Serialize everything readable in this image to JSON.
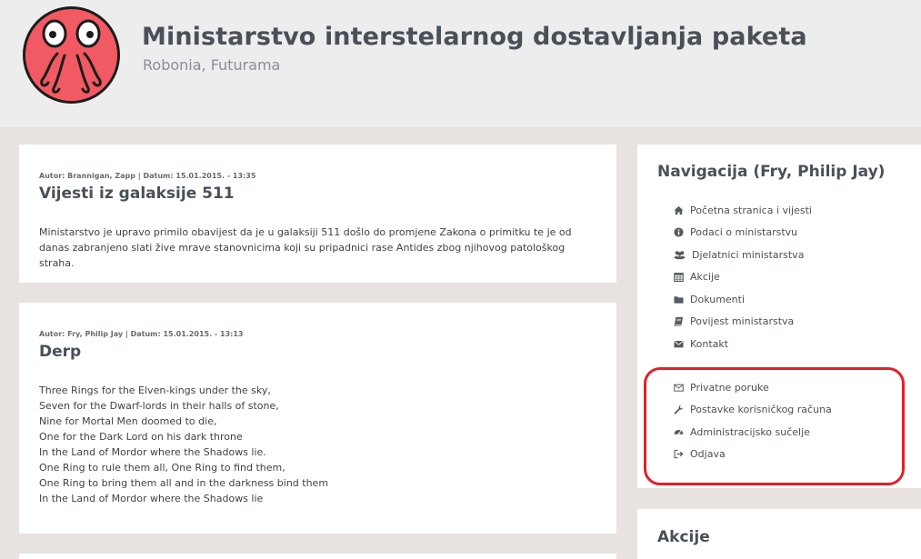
{
  "header": {
    "title": "Ministarstvo interstelarnog dostavljanja paketa",
    "subtitle": "Robonia, Futurama",
    "logo_icon": "zoidberg-logo-icon"
  },
  "posts": [
    {
      "meta": "Autor: Brannigan, Zapp | Datum: 15.01.2015. - 13:35",
      "title": "Vijesti iz galaksije 511",
      "body": "Ministarstvo je upravo primilo obavijest da je u galaksiji 511 došlo do promjene Zakona o primitku te je od danas zabranjeno slati žive mrave stanovnicima koji su pripadnici rase Antides zbog njihovog patološkog straha."
    },
    {
      "meta": "Autor: Fry, Philip Jay | Datum: 15.01.2015. - 13:13",
      "title": "Derp",
      "lines": [
        "Three Rings for the Elven-kings under the sky,",
        "Seven for the Dwarf-lords in their halls of stone,",
        "Nine for Mortal Men doomed to die,",
        "One for the Dark Lord on his dark throne",
        "In the Land of Mordor where the Shadows lie.",
        "One Ring to rule them all, One Ring to find them,",
        "One Ring to bring them all and in the darkness bind them",
        "In the Land of Mordor where the Shadows lie"
      ]
    }
  ],
  "sidebar": {
    "nav_title": "Navigacija (Fry, Philip Jay)",
    "nav_items": [
      {
        "label": "Početna stranica i vijesti",
        "icon": "home-icon"
      },
      {
        "label": "Podaci o ministarstvu",
        "icon": "info-circle-icon"
      },
      {
        "label": "Djelatnici ministarstva",
        "icon": "users-icon"
      },
      {
        "label": "Akcije",
        "icon": "calendar-icon"
      },
      {
        "label": "Dokumenti",
        "icon": "folder-icon"
      },
      {
        "label": "Povijest ministarstva",
        "icon": "book-icon"
      },
      {
        "label": "Kontakt",
        "icon": "envelope-icon"
      }
    ],
    "user_items": [
      {
        "label": "Privatne poruke",
        "icon": "envelope-outline-icon"
      },
      {
        "label": "Postavke korisničkog računa",
        "icon": "wrench-icon"
      },
      {
        "label": "Administracijsko sučelje",
        "icon": "dashboard-icon"
      },
      {
        "label": "Odjava",
        "icon": "sign-out-icon"
      }
    ],
    "actions_title": "Akcije"
  },
  "colors": {
    "page_background": "#e8e2e1",
    "header_background": "#ededed",
    "card_background": "#ffffff",
    "logo_red": "#f25a63",
    "highlight_red": "#e0202a"
  }
}
